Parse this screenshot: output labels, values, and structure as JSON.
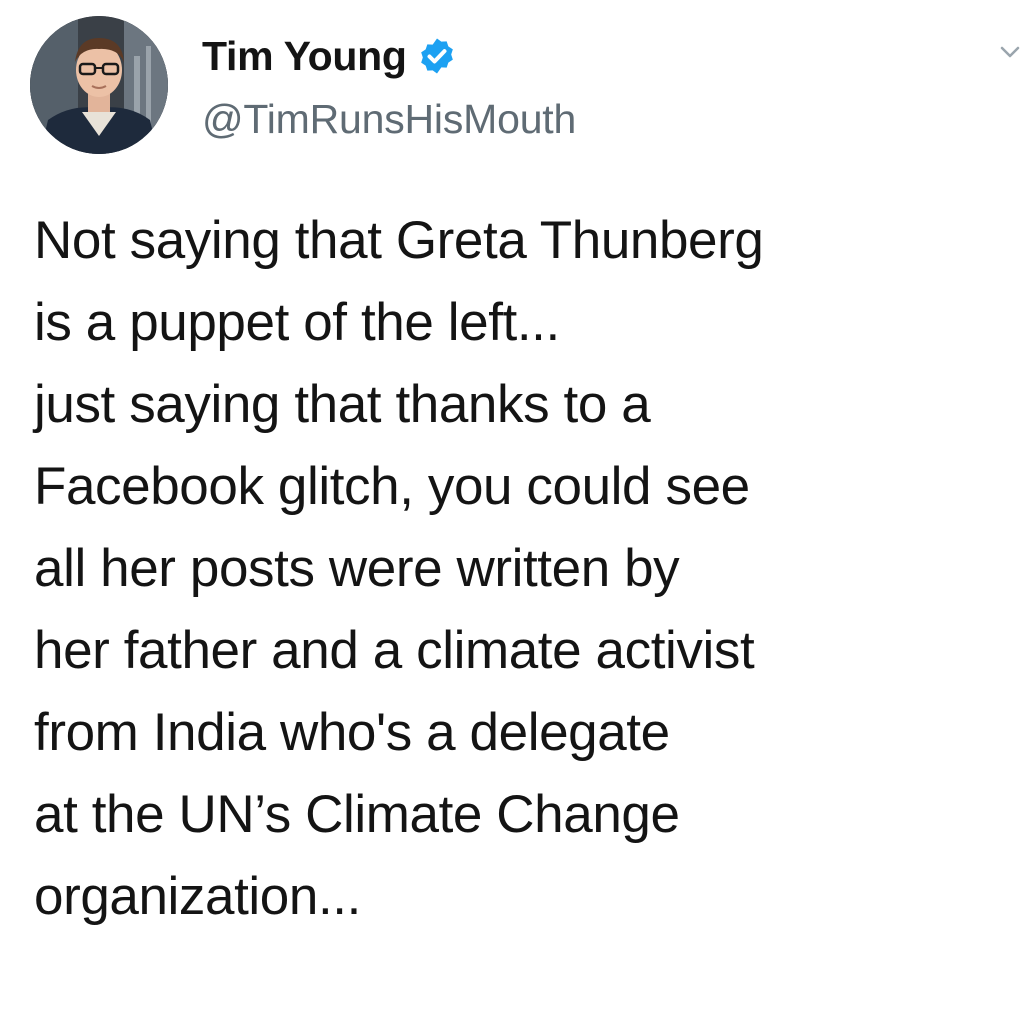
{
  "author": {
    "display_name": "Tim Young",
    "handle": "@TimRunsHisMouth",
    "verified": true,
    "avatar_icon": "profile-photo",
    "verified_icon": "verified-badge-icon"
  },
  "menu": {
    "icon": "chevron-down-icon"
  },
  "tweet": {
    "lines": [
      "Not saying that Greta Thunberg",
      "is a puppet of the left...",
      "just saying that thanks to a",
      "Facebook glitch, you could see",
      "all her posts were written by",
      "her father and a climate activist",
      "from India who's a delegate",
      "at the UN’s Climate Change",
      "organization..."
    ]
  },
  "colors": {
    "background": "#ffffff",
    "text": "#141414",
    "handle": "#5f6b74",
    "verified": "#1da1f2"
  }
}
